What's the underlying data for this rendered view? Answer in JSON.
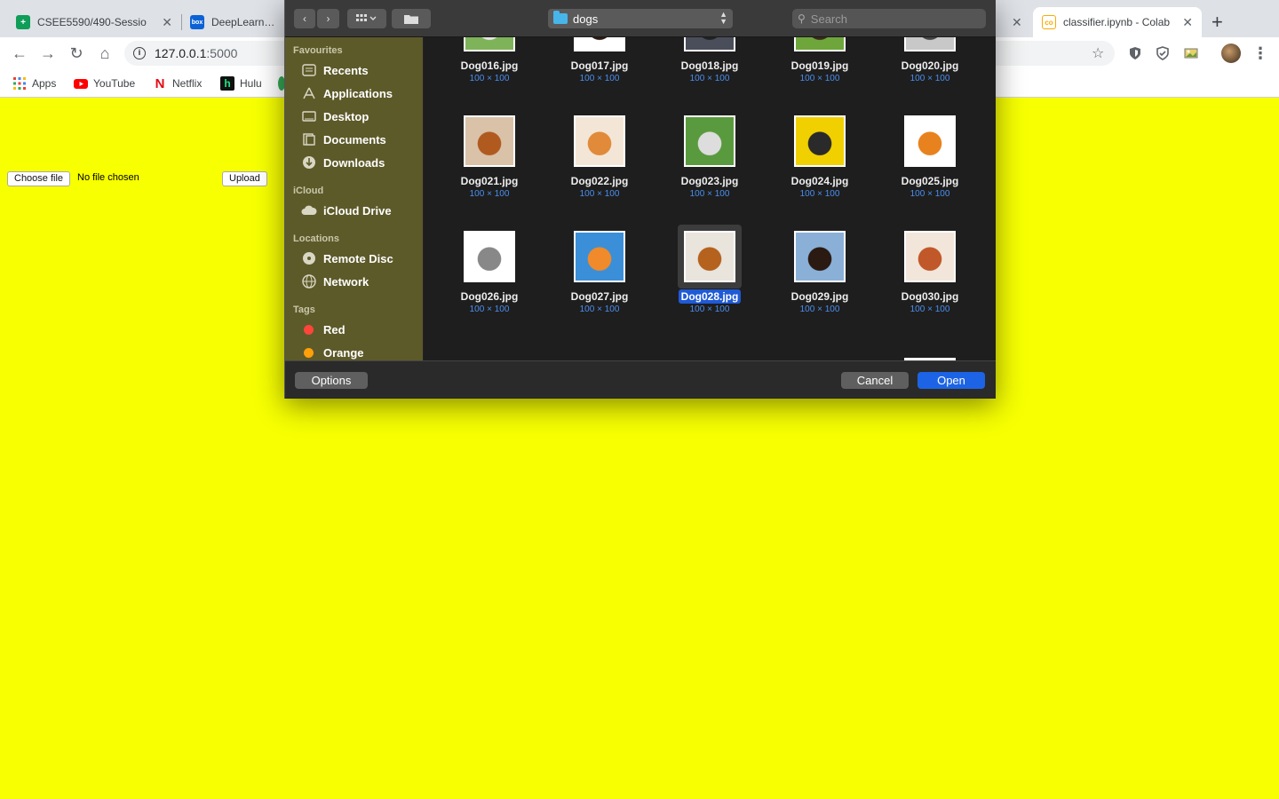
{
  "browser": {
    "tabs": [
      {
        "title": "CSEE5590/490-Sessio",
        "favicon_color": "#0f9d58",
        "favicon_glyph": "+"
      },
      {
        "title": "DeepLearning_",
        "favicon_color": "#0b62d6",
        "favicon_glyph": "box"
      },
      {
        "title": "classifier.ipynb - Colab",
        "favicon_color": "#f9ab00",
        "favicon_glyph": "co"
      }
    ],
    "close_glyph": "✕",
    "new_tab_glyph": "+",
    "url_host": "127.0.0.1",
    "url_port": ":5000",
    "bookmarks": [
      {
        "label": "Apps",
        "icon": "apps-grid-icon"
      },
      {
        "label": "YouTube",
        "icon": "youtube-icon",
        "color": "#ff0000"
      },
      {
        "label": "Netflix",
        "icon": "netflix-icon",
        "color": "#e50914"
      },
      {
        "label": "Hulu",
        "icon": "hulu-icon",
        "color": "#1ce783"
      }
    ]
  },
  "page": {
    "background": "#f7ff00",
    "choose_file_label": "Choose file",
    "no_file_text": "No file chosen",
    "upload_label": "Upload"
  },
  "dialog": {
    "folder": "dogs",
    "search_placeholder": "Search",
    "sidebar": {
      "favourites_heading": "Favourites",
      "favourites": [
        {
          "label": "Recents",
          "icon": "recents-icon"
        },
        {
          "label": "Applications",
          "icon": "applications-icon"
        },
        {
          "label": "Desktop",
          "icon": "desktop-icon"
        },
        {
          "label": "Documents",
          "icon": "documents-icon"
        },
        {
          "label": "Downloads",
          "icon": "downloads-icon"
        }
      ],
      "icloud_heading": "iCloud",
      "icloud": [
        {
          "label": "iCloud Drive",
          "icon": "cloud-icon"
        }
      ],
      "locations_heading": "Locations",
      "locations": [
        {
          "label": "Remote Disc",
          "icon": "disc-icon"
        },
        {
          "label": "Network",
          "icon": "network-icon"
        }
      ],
      "tags_heading": "Tags",
      "tags": [
        {
          "label": "Red",
          "color": "#ff453a"
        },
        {
          "label": "Orange",
          "color": "#ff9f0a"
        }
      ]
    },
    "files": [
      {
        "name": "Dog016.jpg",
        "dims": "100 × 100",
        "colors": [
          "#7fb35a",
          "#e6e6e6"
        ]
      },
      {
        "name": "Dog017.jpg",
        "dims": "100 × 100",
        "colors": [
          "#ffffff",
          "#2a1a10"
        ]
      },
      {
        "name": "Dog018.jpg",
        "dims": "100 × 100",
        "colors": [
          "#4a4e5a",
          "#222222"
        ]
      },
      {
        "name": "Dog019.jpg",
        "dims": "100 × 100",
        "colors": [
          "#6ea63c",
          "#3a2a18"
        ]
      },
      {
        "name": "Dog020.jpg",
        "dims": "100 × 100",
        "colors": [
          "#c8c8c8",
          "#444444"
        ]
      },
      {
        "name": "Dog021.jpg",
        "dims": "100 × 100",
        "colors": [
          "#d9c2a8",
          "#b05a20"
        ]
      },
      {
        "name": "Dog022.jpg",
        "dims": "100 × 100",
        "colors": [
          "#f4e6d6",
          "#e08a3a"
        ]
      },
      {
        "name": "Dog023.jpg",
        "dims": "100 × 100",
        "colors": [
          "#5a9a3e",
          "#dddddd"
        ]
      },
      {
        "name": "Dog024.jpg",
        "dims": "100 × 100",
        "colors": [
          "#f0d000",
          "#2a2a2a"
        ]
      },
      {
        "name": "Dog025.jpg",
        "dims": "100 × 100",
        "colors": [
          "#ffffff",
          "#e8821e"
        ]
      },
      {
        "name": "Dog026.jpg",
        "dims": "100 × 100",
        "colors": [
          "#ffffff",
          "#888888"
        ]
      },
      {
        "name": "Dog027.jpg",
        "dims": "100 × 100",
        "colors": [
          "#3a8fd8",
          "#f08a2a"
        ]
      },
      {
        "name": "Dog028.jpg",
        "dims": "100 × 100",
        "colors": [
          "#e9e4dc",
          "#b4621e"
        ],
        "selected": true
      },
      {
        "name": "Dog029.jpg",
        "dims": "100 × 100",
        "colors": [
          "#8ab0d8",
          "#2a1a12"
        ]
      },
      {
        "name": "Dog030.jpg",
        "dims": "100 × 100",
        "colors": [
          "#f2e6da",
          "#c0582a"
        ]
      }
    ],
    "options_label": "Options",
    "cancel_label": "Cancel",
    "open_label": "Open"
  }
}
